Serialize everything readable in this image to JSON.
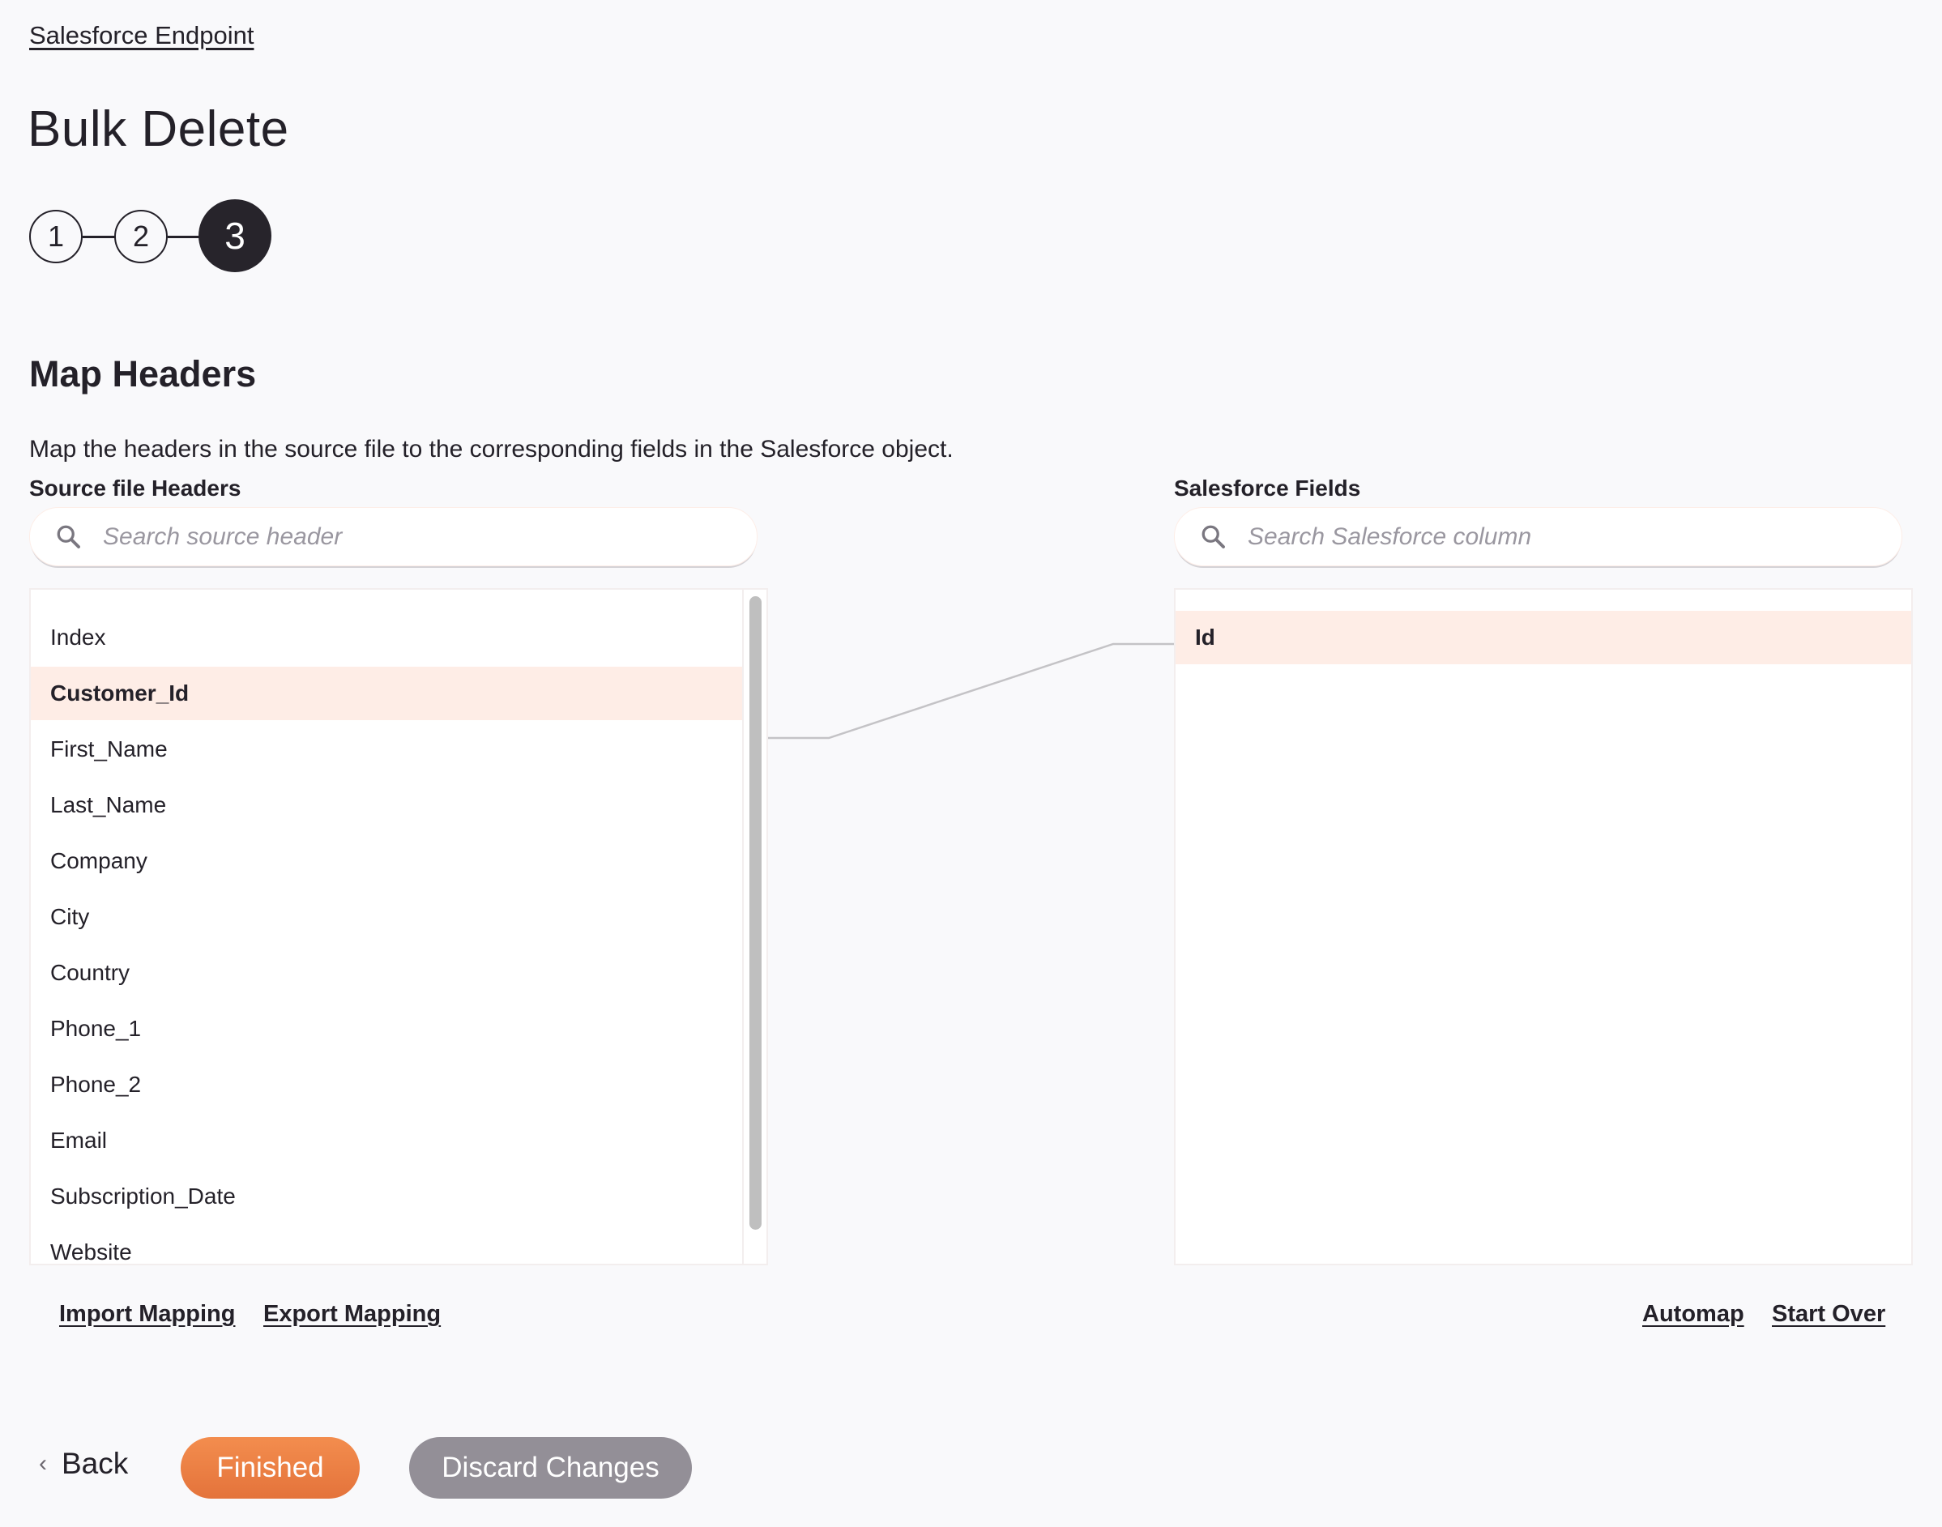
{
  "breadcrumb": "Salesforce Endpoint",
  "title": "Bulk Delete",
  "stepper": {
    "steps": [
      "1",
      "2",
      "3"
    ],
    "current": 3
  },
  "section": {
    "title": "Map Headers",
    "description": "Map the headers in the source file to the corresponding fields in the Salesforce object."
  },
  "source": {
    "label": "Source file Headers",
    "search_placeholder": "Search source header",
    "search_value": "",
    "items": [
      "Index",
      "Customer_Id",
      "First_Name",
      "Last_Name",
      "Company",
      "City",
      "Country",
      "Phone_1",
      "Phone_2",
      "Email",
      "Subscription_Date",
      "Website"
    ],
    "selected": "Customer_Id"
  },
  "target": {
    "label": "Salesforce Fields",
    "search_placeholder": "Search Salesforce column",
    "search_value": "",
    "items": [
      "Id"
    ],
    "selected": "Id"
  },
  "mapping": [
    {
      "source": "Customer_Id",
      "target": "Id"
    }
  ],
  "links": {
    "import": "Import Mapping",
    "export": "Export Mapping",
    "automap": "Automap",
    "start_over": "Start Over"
  },
  "footer": {
    "back": "Back",
    "finished": "Finished",
    "discard": "Discard Changes"
  },
  "colors": {
    "accent": "#ec7d45",
    "selected_row": "#feede6",
    "discard": "#938f97",
    "active_step": "#27242b"
  }
}
